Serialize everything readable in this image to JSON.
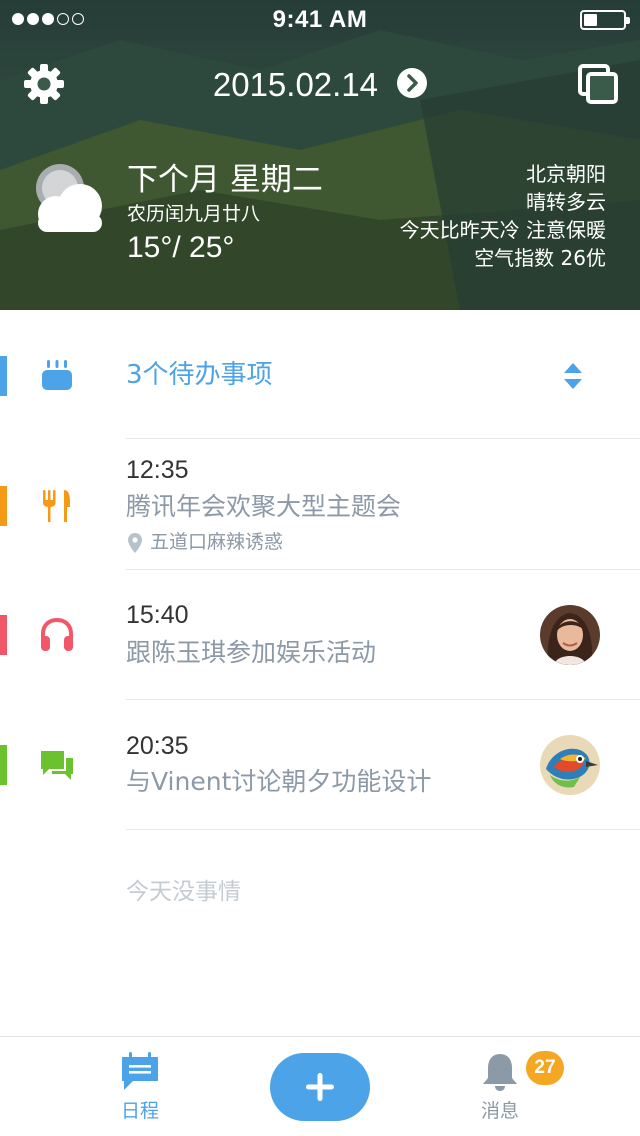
{
  "status_bar": {
    "time": "9:41 AM",
    "battery_level": 0.35
  },
  "header": {
    "date": "2015.02.14",
    "weather": {
      "condition_icon": "partly-cloudy-icon",
      "title": "下个月 星期二",
      "lunar_date": "农历闰九月廿八",
      "temperature": "15°/ 25°",
      "location": "北京朝阳",
      "forecast": "晴转多云",
      "advice": "今天比昨天冷 注意保暖",
      "air_quality": "空气指数 26优"
    }
  },
  "todo": {
    "label": "3个待办事项",
    "icon": "tray-icon",
    "accent_color": "#4ca3e8"
  },
  "events": [
    {
      "time": "12:35",
      "title": "腾讯年会欢聚大型主题会",
      "location": "五道口麻辣诱惑",
      "icon": "fork-knife-icon",
      "accent_color": "#f59a17"
    },
    {
      "time": "15:40",
      "title": "跟陈玉琪参加娱乐活动",
      "icon": "headphones-icon",
      "accent_color": "#f0586a",
      "avatar": "woman-portrait"
    },
    {
      "time": "20:35",
      "title": "与Vinent讨论朝夕功能设计",
      "icon": "chat-bubbles-icon",
      "accent_color": "#6cc12e",
      "avatar": "colorful-bird"
    }
  ],
  "empty_text": "今天没事情",
  "tabbar": {
    "calendar_label": "日程",
    "messages_label": "消息",
    "messages_badge": "27",
    "active_color": "#4ca3e8",
    "inactive_color": "#8c99a6"
  }
}
